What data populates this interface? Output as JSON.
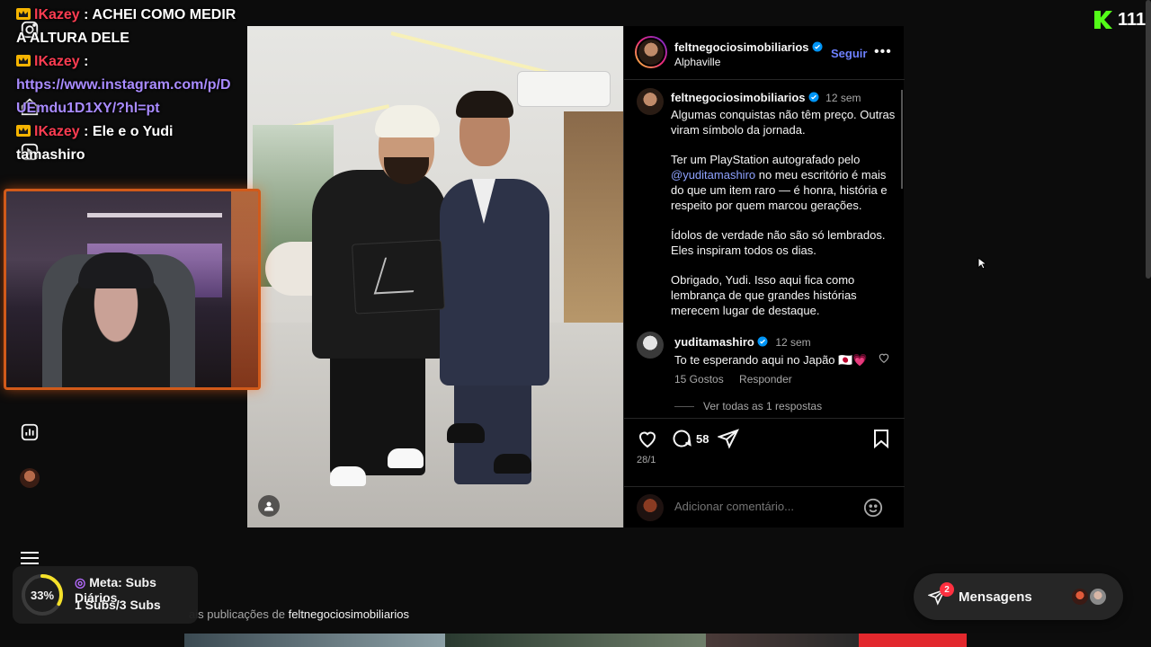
{
  "chat": {
    "messages": [
      {
        "user": "lKazey",
        "sep": " : ",
        "text": "ACHEI COMO MEDIR A ALTURA DELE"
      },
      {
        "user": "lKazey",
        "sep": " :",
        "text": ""
      },
      {
        "link": "https://www.instagram.com/p/DUEmdu1D1XY/?hl=pt"
      },
      {
        "user": "lKazey",
        "sep": " : ",
        "text": "Ele e o Yudi tamashiro"
      }
    ]
  },
  "kick": {
    "viewer_count": "111",
    "accent": "#53fc18"
  },
  "post": {
    "author": "feltnegociosimobiliarios",
    "location": "Alphaville",
    "follow_label": "Seguir",
    "more_label": "•••",
    "caption": {
      "author": "feltnegociosimobiliarios",
      "time": "12 sem",
      "p1": "Algumas conquistas não têm preço. Outras viram símbolo da jornada.",
      "p2_before": "Ter um PlayStation autografado pelo ",
      "p2_mention": "@yuditamashiro",
      "p2_after": " no meu escritório é mais do que um item raro — é honra, história e respeito por quem marcou gerações.",
      "p3": "Ídolos de verdade não são só lembrados. Eles inspiram todos os dias.",
      "p4": "Obrigado, Yudi. Isso aqui fica como lembrança de que grandes histórias merecem lugar de destaque."
    },
    "comment": {
      "author": "yuditamashiro",
      "time": "12 sem",
      "text": "To te esperando aqui no Japão 🇯🇵💗",
      "likes": "15 Gostos",
      "reply_label": "Responder",
      "view_replies": "Ver todas as 1 respostas"
    },
    "comment_count": "58",
    "date": "28/1",
    "add_comment_placeholder": "Adicionar comentário..."
  },
  "more_posts": {
    "prefix": "ais publicações de",
    "author": "feltnegociosimobiliarios"
  },
  "goal": {
    "percent_label": "33%",
    "progress": 0.33,
    "title": "Meta: Subs Diários",
    "subtitle": "1 Subs/3 Subs",
    "accent": "#f5e12a"
  },
  "messages": {
    "label": "Mensagens",
    "badge": "2"
  }
}
